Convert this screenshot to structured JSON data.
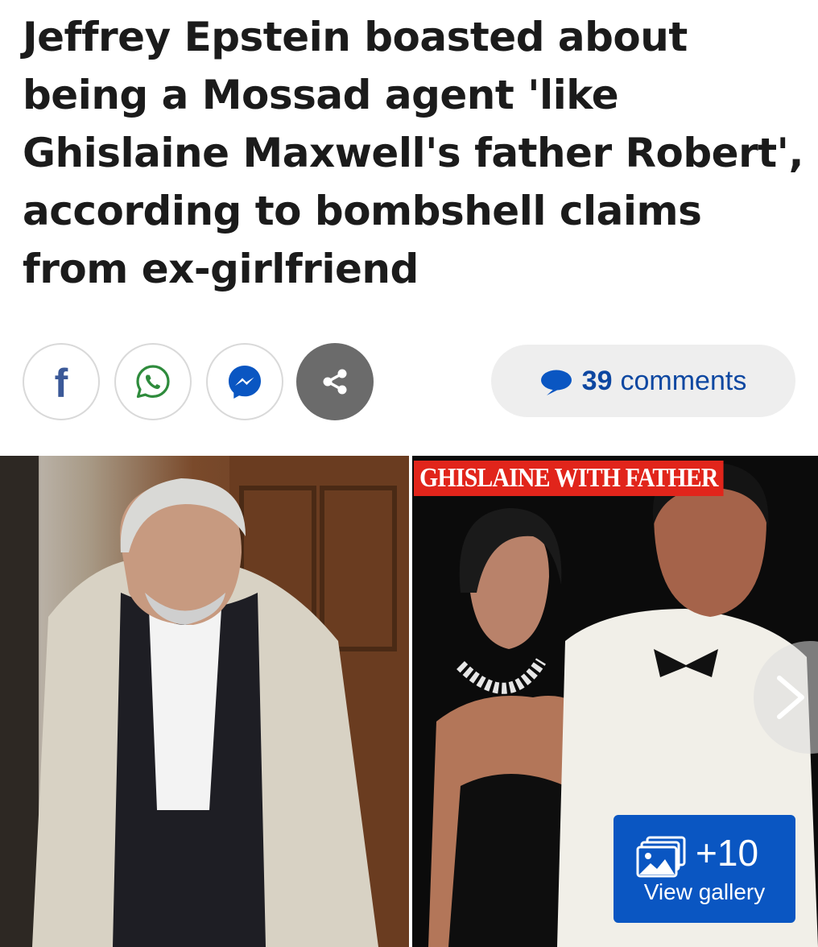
{
  "article": {
    "headline": "Jeffrey Epstein boasted about being a Mossad agent 'like Ghislaine Maxwell's father Robert', according to bombshell claims from ex-girlfriend"
  },
  "share_bar": {
    "facebook_glyph": "f",
    "icons": [
      "facebook-icon",
      "whatsapp-icon",
      "messenger-icon",
      "share-icon"
    ],
    "comments_count": "39",
    "comments_label": "comments",
    "colors": {
      "facebook": "#3b5998",
      "whatsapp": "#2e8b3c",
      "messenger": "#0a56c2",
      "comments_text": "#0d47a1",
      "more_button": "#6b6b6b"
    }
  },
  "gallery": {
    "caption": "GHISLAINE WITH FATHER",
    "count": "+10",
    "view_label": "View gallery",
    "colors": {
      "caption_bg": "#e1251b",
      "button_bg": "#0a56c2"
    }
  }
}
